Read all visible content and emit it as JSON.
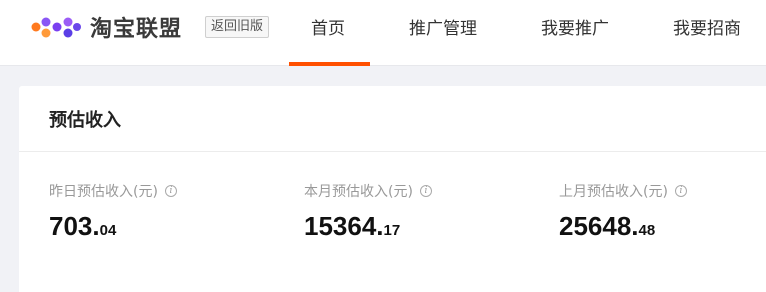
{
  "brand": {
    "name": "淘宝联盟",
    "old_version_label": "返回旧版",
    "logo_colors": [
      "#ff6d1f",
      "#8a56f5",
      "#7a3ff0",
      "#5b3fe6",
      "#ff8a2a",
      "#9b5cf6"
    ]
  },
  "nav": {
    "items": [
      {
        "label": "首页",
        "active": true
      },
      {
        "label": "推广管理",
        "active": false
      },
      {
        "label": "我要推广",
        "active": false
      },
      {
        "label": "我要招商",
        "active": false
      }
    ],
    "accent_color": "#ff5000"
  },
  "card": {
    "title": "预估收入",
    "stats": [
      {
        "label": "昨日预估收入(元)",
        "integer": "703.",
        "decimal": "04",
        "icon": "info-icon"
      },
      {
        "label": "本月预估收入(元)",
        "integer": "15364.",
        "decimal": "17",
        "icon": "info-icon"
      },
      {
        "label": "上月预估收入(元)",
        "integer": "25648.",
        "decimal": "48",
        "icon": "info-icon"
      }
    ]
  }
}
